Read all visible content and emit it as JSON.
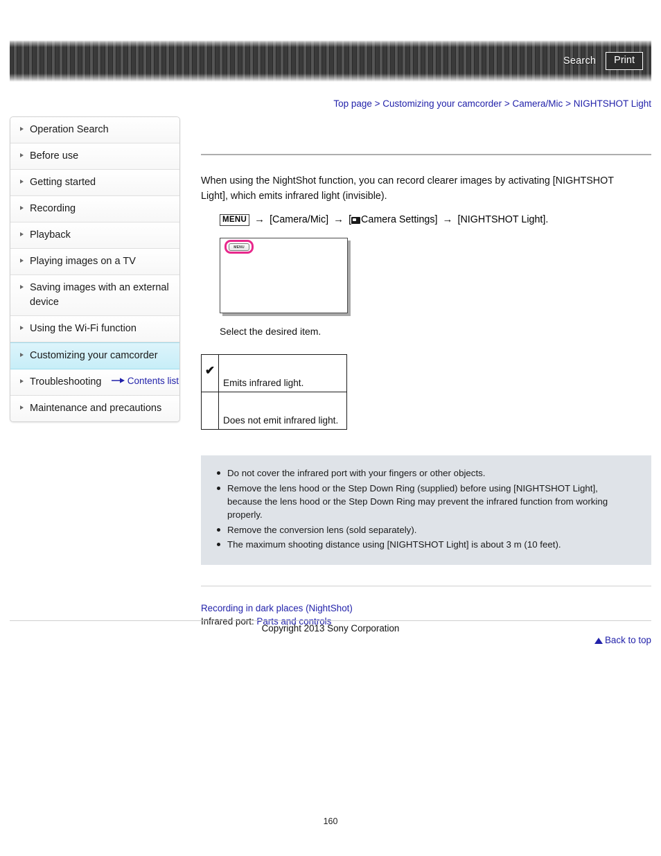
{
  "header": {
    "search_label": "Search",
    "print_label": "Print"
  },
  "breadcrumb": {
    "items": [
      {
        "label": "Top page"
      },
      {
        "label": "Customizing your camcorder"
      },
      {
        "label": "Camera/Mic"
      },
      {
        "label": "NIGHTSHOT Light"
      }
    ],
    "separator": ">"
  },
  "sidebar": {
    "items": [
      {
        "label": "Operation Search",
        "active": false
      },
      {
        "label": "Before use",
        "active": false
      },
      {
        "label": "Getting started",
        "active": false
      },
      {
        "label": "Recording",
        "active": false
      },
      {
        "label": "Playback",
        "active": false
      },
      {
        "label": "Playing images on a TV",
        "active": false
      },
      {
        "label": "Saving images with an external device",
        "active": false
      },
      {
        "label": "Using the Wi-Fi function",
        "active": false
      },
      {
        "label": "Customizing your camcorder",
        "active": true
      },
      {
        "label": "Troubleshooting",
        "active": false
      },
      {
        "label": "Maintenance and precautions",
        "active": false
      }
    ],
    "contents_list_label": "Contents list"
  },
  "main": {
    "intro": "When using the NightShot function, you can record clearer images by activating [NIGHTSHOT Light], which emits infrared light (invisible).",
    "menu_path": {
      "menu_chip": "MENU",
      "arrow": "→",
      "step1": "[Camera/Mic]",
      "step2_open": "[",
      "step2": "Camera Settings]",
      "step3": "[NIGHTSHOT Light]."
    },
    "figure": {
      "menu_button_label": "MENU",
      "highlight_color": "#e8288c"
    },
    "select_caption": "Select the desired item.",
    "options": [
      {
        "mark": "✔",
        "label": "Emits infrared light."
      },
      {
        "mark": "",
        "label": "Does not emit infrared light."
      }
    ],
    "notes": [
      "Do not cover the infrared port with your fingers or other objects.",
      "Remove the lens hood or the Step Down Ring (supplied) before using [NIGHTSHOT Light], because the lens hood or the Step Down Ring may prevent the infrared function from working properly.",
      "Remove the conversion lens (sold separately).",
      "The maximum shooting distance using [NIGHTSHOT Light] is about 3 m (10 feet)."
    ],
    "related": {
      "link1": "Recording in dark places (NightShot)",
      "line2_prefix": "Infrared port: ",
      "link2": "Parts and controls"
    },
    "back_to_top_label": "Back to top"
  },
  "footer": {
    "copyright": "Copyright 2013 Sony Corporation",
    "page_number": "160"
  },
  "colors": {
    "link": "#2222aa",
    "notes_background": "#dfe3e8",
    "sidebar_active": "#c7eef8",
    "highlight_pink": "#e8288c"
  }
}
